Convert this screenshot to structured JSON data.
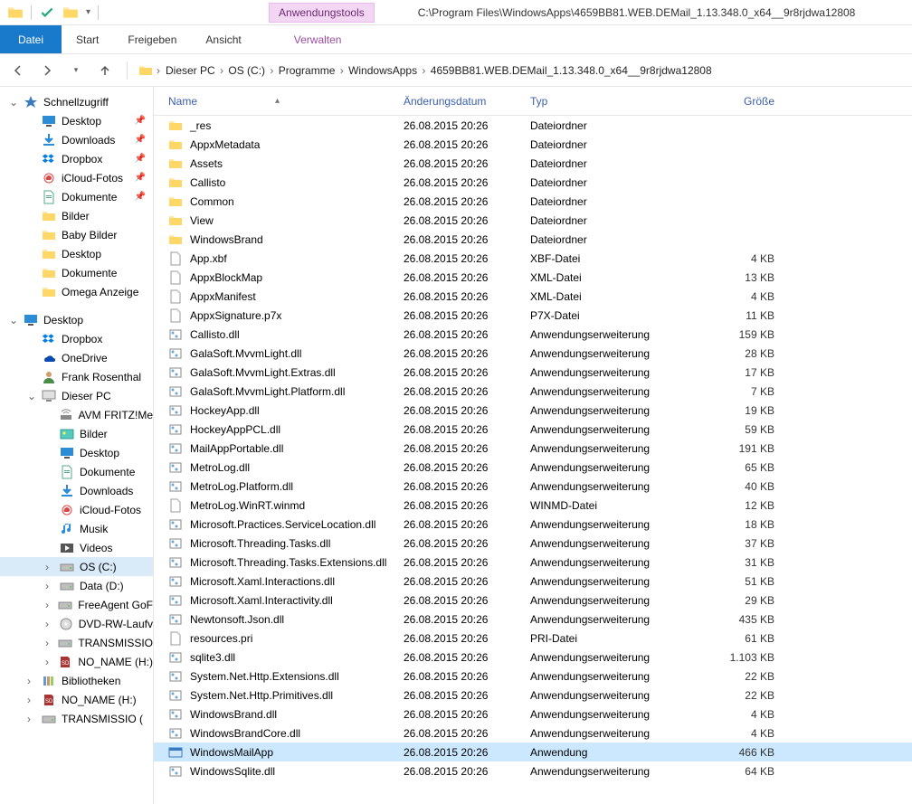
{
  "title_path": "C:\\Program Files\\WindowsApps\\4659BB81.WEB.DEMail_1.13.348.0_x64__9r8rjdwa12808",
  "tools_tab": "Anwendungstools",
  "ribbon": {
    "file": "Datei",
    "start": "Start",
    "share": "Freigeben",
    "view": "Ansicht",
    "manage": "Verwalten"
  },
  "breadcrumb": [
    "Dieser PC",
    "OS (C:)",
    "Programme",
    "WindowsApps",
    "4659BB81.WEB.DEMail_1.13.348.0_x64__9r8rjdwa12808"
  ],
  "columns": {
    "name": "Name",
    "date": "Änderungsdatum",
    "type": "Typ",
    "size": "Größe"
  },
  "sidebar": [
    {
      "kind": "hdr",
      "label": "Schnellzugriff",
      "icon": "star",
      "caret": "open"
    },
    {
      "kind": "item",
      "label": "Desktop",
      "icon": "desktop",
      "pin": true
    },
    {
      "kind": "item",
      "label": "Downloads",
      "icon": "download",
      "pin": true
    },
    {
      "kind": "item",
      "label": "Dropbox",
      "icon": "dropbox",
      "pin": true
    },
    {
      "kind": "item",
      "label": "iCloud-Fotos",
      "icon": "icloud",
      "pin": true
    },
    {
      "kind": "item",
      "label": "Dokumente",
      "icon": "docs",
      "pin": true
    },
    {
      "kind": "item",
      "label": "Bilder",
      "icon": "folder"
    },
    {
      "kind": "item",
      "label": "Baby Bilder",
      "icon": "folder"
    },
    {
      "kind": "item",
      "label": "Desktop",
      "icon": "folder"
    },
    {
      "kind": "item",
      "label": "Dokumente",
      "icon": "folder"
    },
    {
      "kind": "item",
      "label": "Omega Anzeige",
      "icon": "folder"
    },
    {
      "kind": "blank"
    },
    {
      "kind": "hdr",
      "label": "Desktop",
      "icon": "desktop",
      "caret": "open"
    },
    {
      "kind": "item",
      "label": "Dropbox",
      "icon": "dropbox"
    },
    {
      "kind": "item",
      "label": "OneDrive",
      "icon": "onedrive"
    },
    {
      "kind": "item",
      "label": "Frank Rosenthal",
      "icon": "user"
    },
    {
      "kind": "item",
      "label": "Dieser PC",
      "icon": "pc",
      "caret": "open"
    },
    {
      "kind": "item2",
      "label": "AVM FRITZ!Me",
      "icon": "router"
    },
    {
      "kind": "item2",
      "label": "Bilder",
      "icon": "pictures"
    },
    {
      "kind": "item2",
      "label": "Desktop",
      "icon": "desktop"
    },
    {
      "kind": "item2",
      "label": "Dokumente",
      "icon": "docs"
    },
    {
      "kind": "item2",
      "label": "Downloads",
      "icon": "download"
    },
    {
      "kind": "item2",
      "label": "iCloud-Fotos",
      "icon": "icloud"
    },
    {
      "kind": "item2",
      "label": "Musik",
      "icon": "music"
    },
    {
      "kind": "item2",
      "label": "Videos",
      "icon": "video"
    },
    {
      "kind": "item2",
      "label": "OS (C:)",
      "icon": "drive",
      "selected": true,
      "caret": "closed"
    },
    {
      "kind": "item2",
      "label": "Data (D:)",
      "icon": "drive",
      "caret": "closed"
    },
    {
      "kind": "item2",
      "label": "FreeAgent GoF",
      "icon": "drive",
      "caret": "closed"
    },
    {
      "kind": "item2",
      "label": "DVD-RW-Laufv",
      "icon": "dvd",
      "caret": "closed"
    },
    {
      "kind": "item2",
      "label": "TRANSMISSIO",
      "icon": "drive",
      "caret": "closed"
    },
    {
      "kind": "item2",
      "label": "NO_NAME (H:)",
      "icon": "sd",
      "caret": "closed"
    },
    {
      "kind": "item",
      "label": "Bibliotheken",
      "icon": "library",
      "caret": "closed"
    },
    {
      "kind": "item",
      "label": "NO_NAME (H:)",
      "icon": "sd",
      "caret": "closed"
    },
    {
      "kind": "item",
      "label": "TRANSMISSIO (",
      "icon": "drive",
      "caret": "closed"
    }
  ],
  "files": [
    {
      "name": "_res",
      "date": "26.08.2015 20:26",
      "type": "Dateiordner",
      "size": "",
      "icon": "folder"
    },
    {
      "name": "AppxMetadata",
      "date": "26.08.2015 20:26",
      "type": "Dateiordner",
      "size": "",
      "icon": "folder"
    },
    {
      "name": "Assets",
      "date": "26.08.2015 20:26",
      "type": "Dateiordner",
      "size": "",
      "icon": "folder"
    },
    {
      "name": "Callisto",
      "date": "26.08.2015 20:26",
      "type": "Dateiordner",
      "size": "",
      "icon": "folder"
    },
    {
      "name": "Common",
      "date": "26.08.2015 20:26",
      "type": "Dateiordner",
      "size": "",
      "icon": "folder"
    },
    {
      "name": "View",
      "date": "26.08.2015 20:26",
      "type": "Dateiordner",
      "size": "",
      "icon": "folder"
    },
    {
      "name": "WindowsBrand",
      "date": "26.08.2015 20:26",
      "type": "Dateiordner",
      "size": "",
      "icon": "folder"
    },
    {
      "name": "App.xbf",
      "date": "26.08.2015 20:26",
      "type": "XBF-Datei",
      "size": "4 KB",
      "icon": "file"
    },
    {
      "name": "AppxBlockMap",
      "date": "26.08.2015 20:26",
      "type": "XML-Datei",
      "size": "13 KB",
      "icon": "file"
    },
    {
      "name": "AppxManifest",
      "date": "26.08.2015 20:26",
      "type": "XML-Datei",
      "size": "4 KB",
      "icon": "file"
    },
    {
      "name": "AppxSignature.p7x",
      "date": "26.08.2015 20:26",
      "type": "P7X-Datei",
      "size": "11 KB",
      "icon": "file"
    },
    {
      "name": "Callisto.dll",
      "date": "26.08.2015 20:26",
      "type": "Anwendungserweiterung",
      "size": "159 KB",
      "icon": "dll"
    },
    {
      "name": "GalaSoft.MvvmLight.dll",
      "date": "26.08.2015 20:26",
      "type": "Anwendungserweiterung",
      "size": "28 KB",
      "icon": "dll"
    },
    {
      "name": "GalaSoft.MvvmLight.Extras.dll",
      "date": "26.08.2015 20:26",
      "type": "Anwendungserweiterung",
      "size": "17 KB",
      "icon": "dll"
    },
    {
      "name": "GalaSoft.MvvmLight.Platform.dll",
      "date": "26.08.2015 20:26",
      "type": "Anwendungserweiterung",
      "size": "7 KB",
      "icon": "dll"
    },
    {
      "name": "HockeyApp.dll",
      "date": "26.08.2015 20:26",
      "type": "Anwendungserweiterung",
      "size": "19 KB",
      "icon": "dll"
    },
    {
      "name": "HockeyAppPCL.dll",
      "date": "26.08.2015 20:26",
      "type": "Anwendungserweiterung",
      "size": "59 KB",
      "icon": "dll"
    },
    {
      "name": "MailAppPortable.dll",
      "date": "26.08.2015 20:26",
      "type": "Anwendungserweiterung",
      "size": "191 KB",
      "icon": "dll"
    },
    {
      "name": "MetroLog.dll",
      "date": "26.08.2015 20:26",
      "type": "Anwendungserweiterung",
      "size": "65 KB",
      "icon": "dll"
    },
    {
      "name": "MetroLog.Platform.dll",
      "date": "26.08.2015 20:26",
      "type": "Anwendungserweiterung",
      "size": "40 KB",
      "icon": "dll"
    },
    {
      "name": "MetroLog.WinRT.winmd",
      "date": "26.08.2015 20:26",
      "type": "WINMD-Datei",
      "size": "12 KB",
      "icon": "file"
    },
    {
      "name": "Microsoft.Practices.ServiceLocation.dll",
      "date": "26.08.2015 20:26",
      "type": "Anwendungserweiterung",
      "size": "18 KB",
      "icon": "dll"
    },
    {
      "name": "Microsoft.Threading.Tasks.dll",
      "date": "26.08.2015 20:26",
      "type": "Anwendungserweiterung",
      "size": "37 KB",
      "icon": "dll"
    },
    {
      "name": "Microsoft.Threading.Tasks.Extensions.dll",
      "date": "26.08.2015 20:26",
      "type": "Anwendungserweiterung",
      "size": "31 KB",
      "icon": "dll"
    },
    {
      "name": "Microsoft.Xaml.Interactions.dll",
      "date": "26.08.2015 20:26",
      "type": "Anwendungserweiterung",
      "size": "51 KB",
      "icon": "dll"
    },
    {
      "name": "Microsoft.Xaml.Interactivity.dll",
      "date": "26.08.2015 20:26",
      "type": "Anwendungserweiterung",
      "size": "29 KB",
      "icon": "dll"
    },
    {
      "name": "Newtonsoft.Json.dll",
      "date": "26.08.2015 20:26",
      "type": "Anwendungserweiterung",
      "size": "435 KB",
      "icon": "dll"
    },
    {
      "name": "resources.pri",
      "date": "26.08.2015 20:26",
      "type": "PRI-Datei",
      "size": "61 KB",
      "icon": "file"
    },
    {
      "name": "sqlite3.dll",
      "date": "26.08.2015 20:26",
      "type": "Anwendungserweiterung",
      "size": "1.103 KB",
      "icon": "dll"
    },
    {
      "name": "System.Net.Http.Extensions.dll",
      "date": "26.08.2015 20:26",
      "type": "Anwendungserweiterung",
      "size": "22 KB",
      "icon": "dll"
    },
    {
      "name": "System.Net.Http.Primitives.dll",
      "date": "26.08.2015 20:26",
      "type": "Anwendungserweiterung",
      "size": "22 KB",
      "icon": "dll"
    },
    {
      "name": "WindowsBrand.dll",
      "date": "26.08.2015 20:26",
      "type": "Anwendungserweiterung",
      "size": "4 KB",
      "icon": "dll"
    },
    {
      "name": "WindowsBrandCore.dll",
      "date": "26.08.2015 20:26",
      "type": "Anwendungserweiterung",
      "size": "4 KB",
      "icon": "dll"
    },
    {
      "name": "WindowsMailApp",
      "date": "26.08.2015 20:26",
      "type": "Anwendung",
      "size": "466 KB",
      "icon": "exe",
      "selected": true
    },
    {
      "name": "WindowsSqlite.dll",
      "date": "26.08.2015 20:26",
      "type": "Anwendungserweiterung",
      "size": "64 KB",
      "icon": "dll"
    }
  ]
}
